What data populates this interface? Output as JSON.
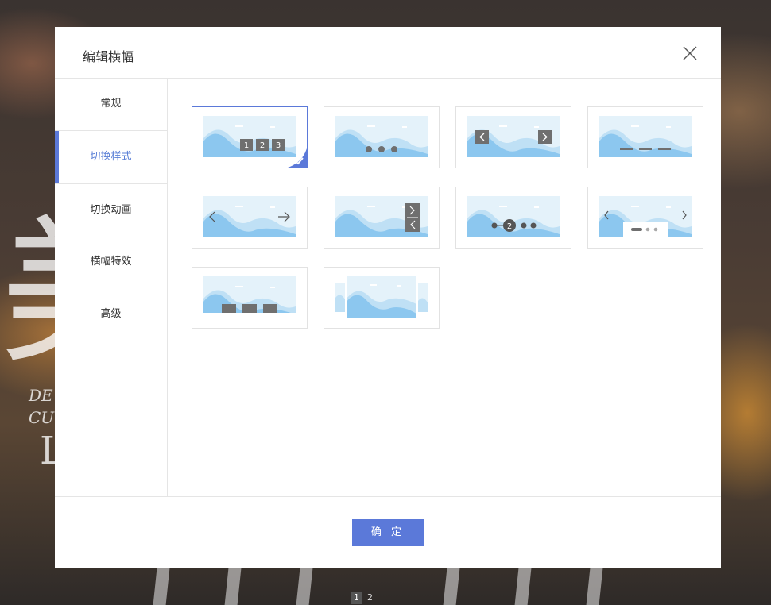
{
  "background": {
    "big_text": "美",
    "script_lines": [
      "DE",
      "CU",
      "L"
    ]
  },
  "modal": {
    "title": "编辑横幅"
  },
  "sidebar": {
    "items": [
      {
        "label": "常规"
      },
      {
        "label": "切换样式"
      },
      {
        "label": "切换动画"
      },
      {
        "label": "横幅特效"
      },
      {
        "label": "高级"
      }
    ],
    "active_index": 1
  },
  "styles": {
    "selected_index": 0,
    "numbers": [
      "1",
      "2",
      "3"
    ],
    "marker_number": "2"
  },
  "footer": {
    "confirm_label": "确 定"
  },
  "pager": {
    "pages": [
      "1",
      "2"
    ],
    "current": "1"
  },
  "colors": {
    "accent": "#5b79d9",
    "thumb_bg": "#e4f2fa",
    "wave_light": "#bfe0f5",
    "wave_dark": "#8cc7ef",
    "control_gray": "#6f6f6f"
  }
}
